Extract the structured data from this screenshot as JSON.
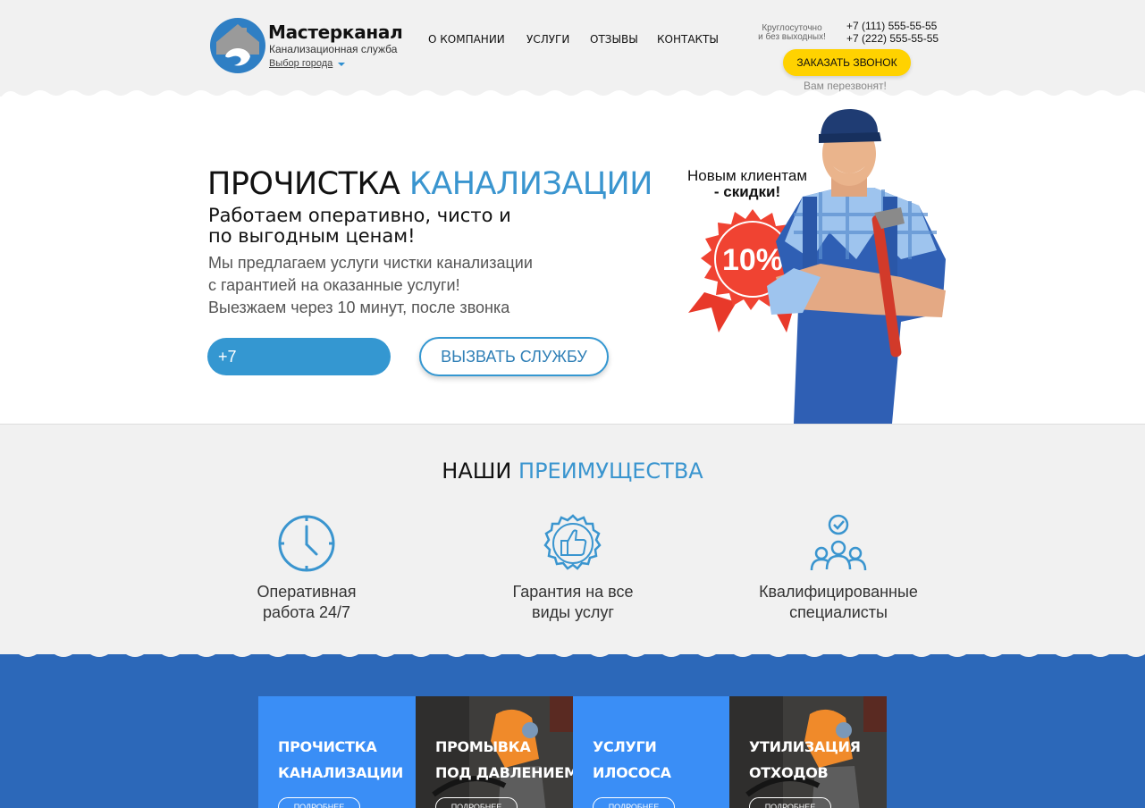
{
  "header": {
    "brand_name": "Мастерканал",
    "brand_sub": "Канализационная служба",
    "city_select": "Выбор города",
    "nav": [
      "О КОМПАНИИ",
      "УСЛУГИ",
      "ОТЗЫВЫ",
      "КОНТАКТЫ"
    ],
    "hours_line1": "Круглосуточно",
    "hours_line2": "и без выходных!",
    "phones": [
      "+7 (111) 555-55-55",
      "+7 (222) 555-55-55"
    ],
    "callback_button": "ЗАКАЗАТЬ ЗВОНОК",
    "callback_note": "Вам перезвонят!"
  },
  "hero": {
    "title_black": "ПРОЧИСТКА",
    "title_blue": "КАНАЛИЗАЦИИ",
    "subtitle_line1": "Работаем оперативно, чисто и",
    "subtitle_line2": "по выгодным ценам!",
    "desc_line1": "Мы предлагаем услуги чистки канализации",
    "desc_line2": "с гарантией на оказанные услуги!",
    "desc_line3": "Выезжаем через 10 минут, после звонка",
    "phone_input_value": "+7",
    "call_button": "ВЫЗВАТЬ СЛУЖБУ",
    "promo_line1": "Новым клиентам",
    "promo_line2": "- скидки!",
    "discount": "10%"
  },
  "advantages": {
    "title_black": "НАШИ",
    "title_blue": "ПРЕИМУЩЕСТВА",
    "items": [
      {
        "icon": "clock-icon",
        "line1": "Оперативная",
        "line2": "работа 24/7"
      },
      {
        "icon": "thumbs-up-icon",
        "line1": "Гарантия на все",
        "line2": "виды услуг"
      },
      {
        "icon": "team-icon",
        "line1": "Квалифицированные",
        "line2": "специалисты"
      }
    ]
  },
  "services": {
    "more_label": "ПОДРОБНЕЕ",
    "items": [
      {
        "line1": "ПРОЧИСТКА",
        "line2": "КАНАЛИЗАЦИИ",
        "style": "blue"
      },
      {
        "line1": "ПРОМЫВКА",
        "line2": "ПОД ДАВЛЕНИЕМ",
        "style": "photo"
      },
      {
        "line1": "УСЛУГИ",
        "line2": "ИЛОСОСА",
        "style": "blue"
      },
      {
        "line1": "УТИЛИЗАЦИЯ",
        "line2": "ОТХОДОВ",
        "style": "photo"
      }
    ]
  },
  "colors": {
    "accent_blue": "#3a95cf",
    "button_yellow": "#ffd200",
    "services_bg": "#2c68b9",
    "card_blue": "#3a8ef6",
    "badge_red": "#f04332"
  }
}
